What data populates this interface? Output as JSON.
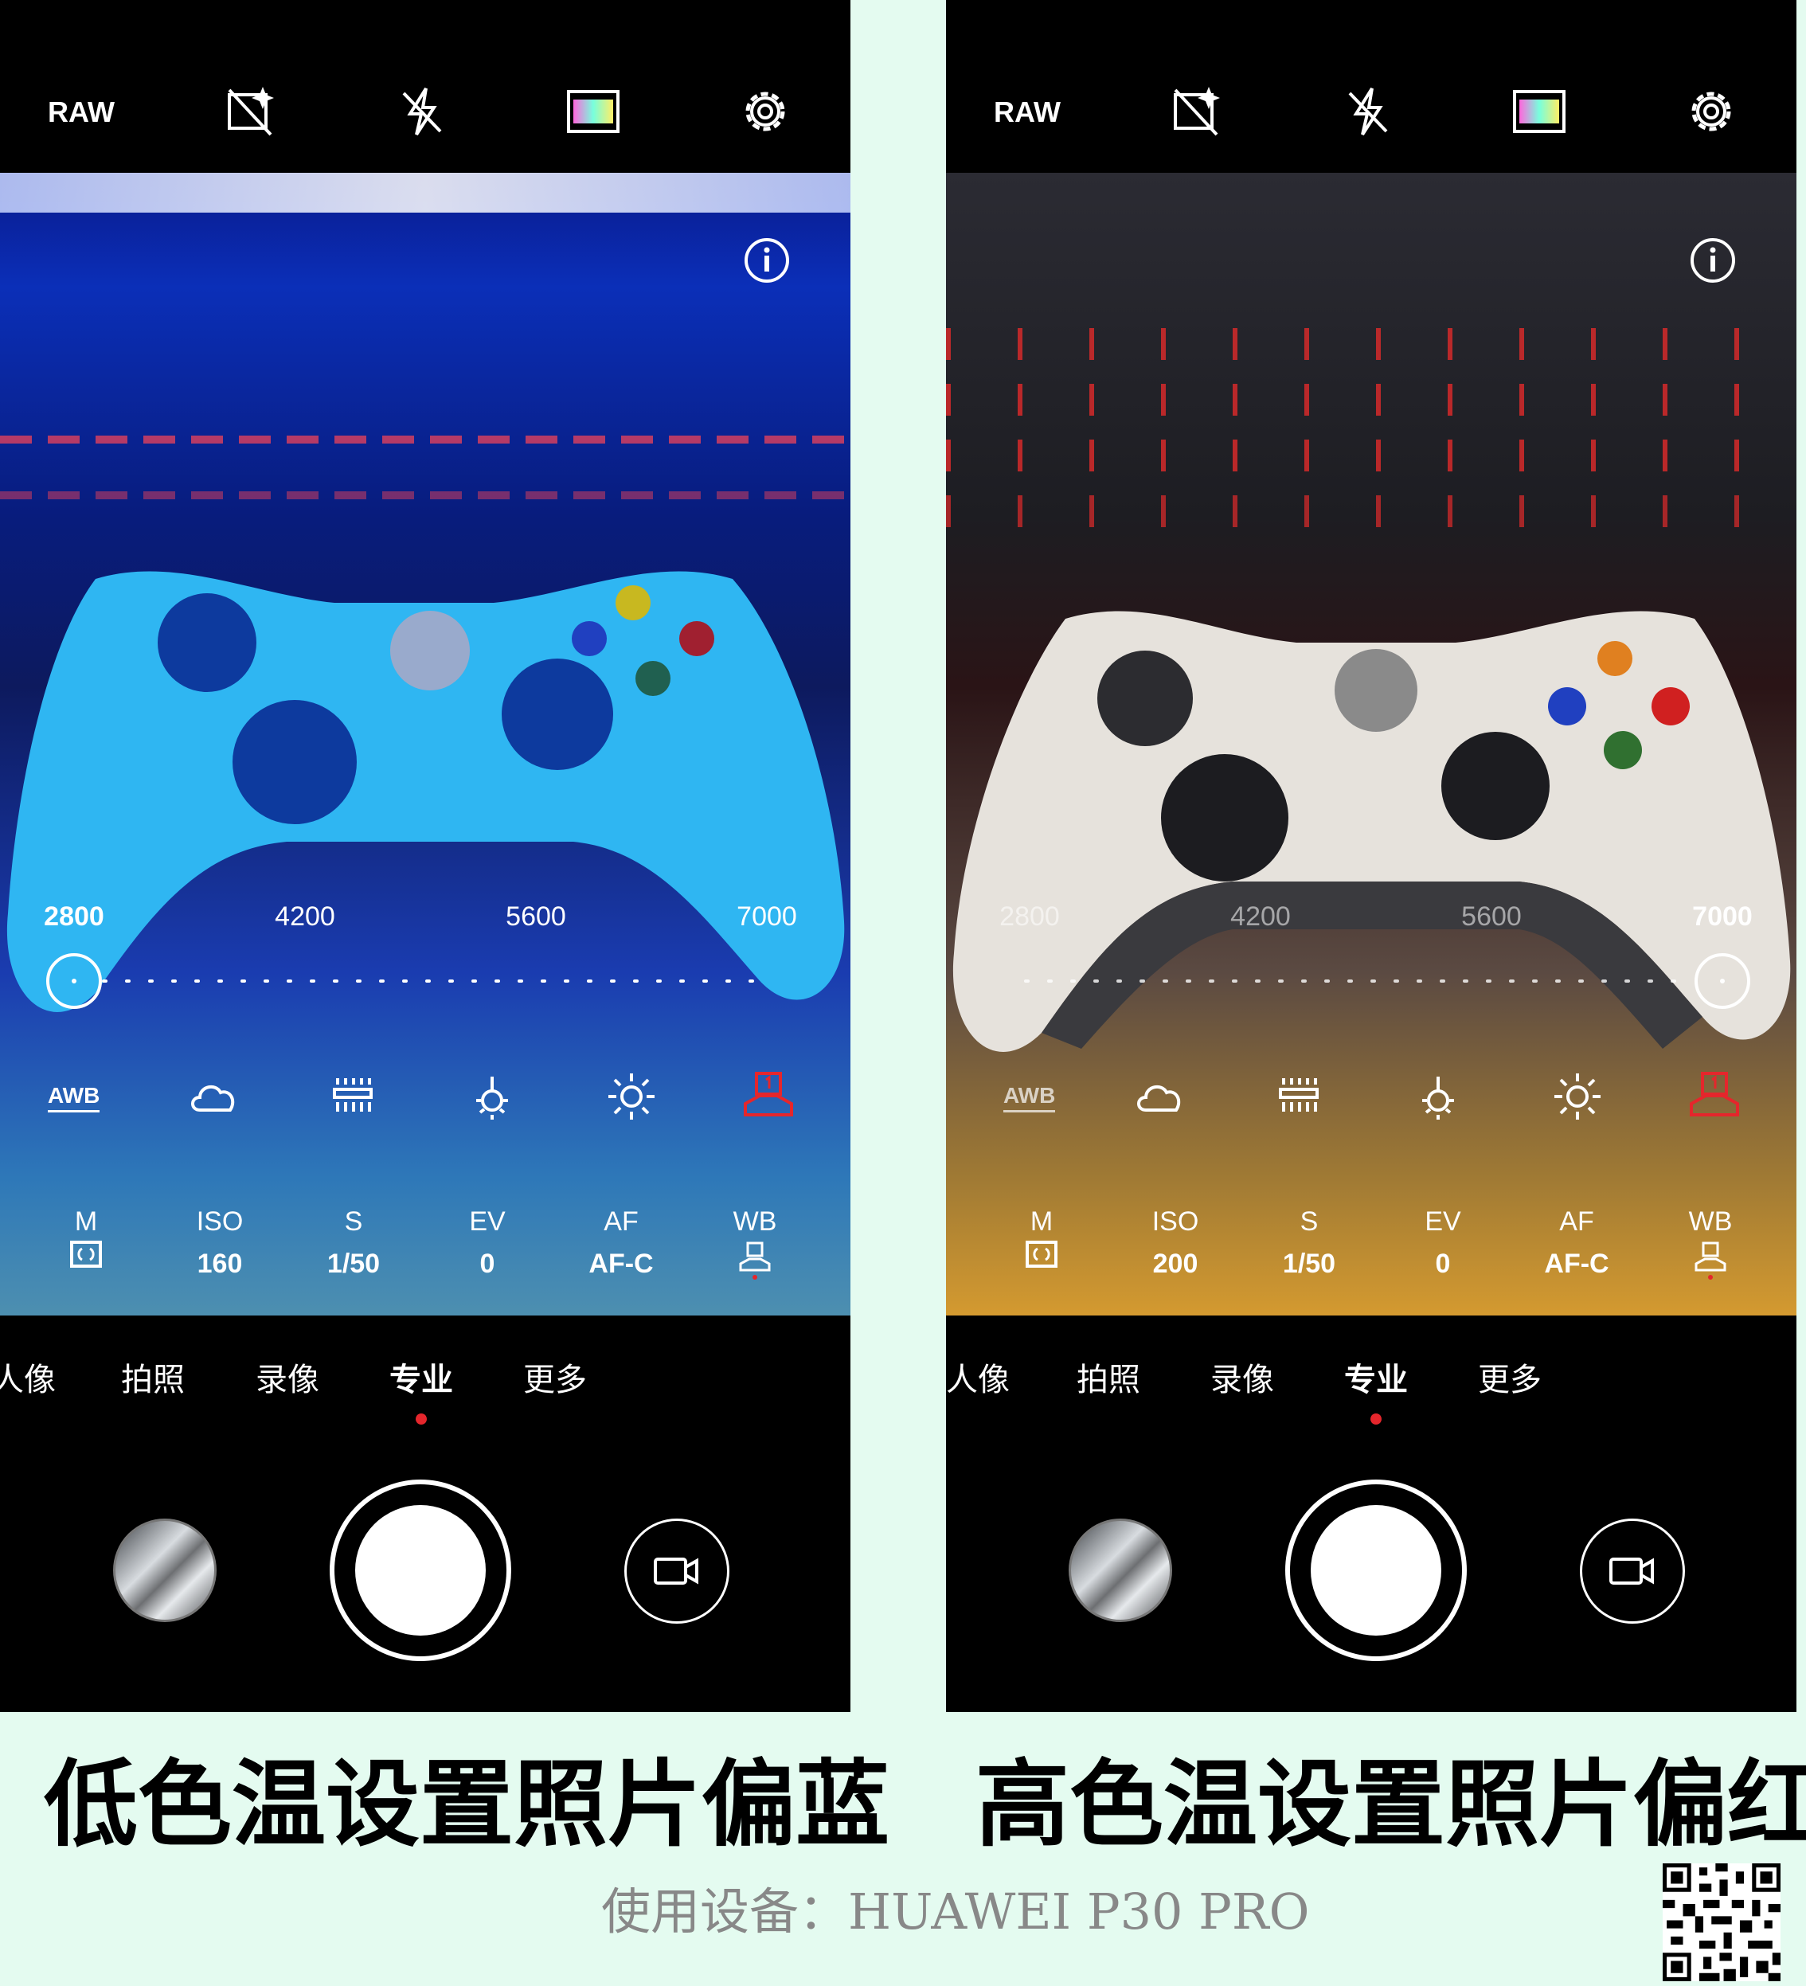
{
  "panels": [
    {
      "id": "left",
      "top_bar": {
        "raw_label": "RAW"
      },
      "wb_scale": {
        "ticks": [
          "2800",
          "4200",
          "5600",
          "7000"
        ],
        "selected": "2800"
      },
      "awb_label": "AWB",
      "params": [
        {
          "label": "M",
          "value": ""
        },
        {
          "label": "ISO",
          "value": "160"
        },
        {
          "label": "S",
          "value": "1/50"
        },
        {
          "label": "EV",
          "value": "0"
        },
        {
          "label": "AF",
          "value": "AF-C"
        },
        {
          "label": "WB",
          "value": ""
        }
      ],
      "mode_tabs": [
        "人像",
        "拍照",
        "录像",
        "专业",
        "更多"
      ],
      "active_tab": "专业",
      "caption": "低色温设置照片偏蓝"
    },
    {
      "id": "right",
      "top_bar": {
        "raw_label": "RAW"
      },
      "wb_scale": {
        "ticks": [
          "2800",
          "4200",
          "5600",
          "7000"
        ],
        "selected": "7000"
      },
      "awb_label": "AWB",
      "params": [
        {
          "label": "M",
          "value": ""
        },
        {
          "label": "ISO",
          "value": "200"
        },
        {
          "label": "S",
          "value": "1/50"
        },
        {
          "label": "EV",
          "value": "0"
        },
        {
          "label": "AF",
          "value": "AF-C"
        },
        {
          "label": "WB",
          "value": ""
        }
      ],
      "mode_tabs": [
        "人像",
        "拍照",
        "录像",
        "专业",
        "更多"
      ],
      "active_tab": "专业",
      "caption": "高色温设置照片偏红"
    }
  ],
  "device_label": "使用设备：HUAWEI P30 PRO",
  "colors": {
    "accent_red": "#e5262c",
    "caption_bg": "#e4fbf0",
    "device_text": "#888888"
  },
  "icons": [
    "no-ai-icon",
    "flash-off-icon",
    "color-filter-icon",
    "settings-gear-icon",
    "info-icon",
    "cloudy-icon",
    "fluorescent-icon",
    "incandescent-icon",
    "sunny-icon",
    "custom-wb-icon",
    "metering-icon",
    "video-camera-icon",
    "qr-code-icon"
  ]
}
